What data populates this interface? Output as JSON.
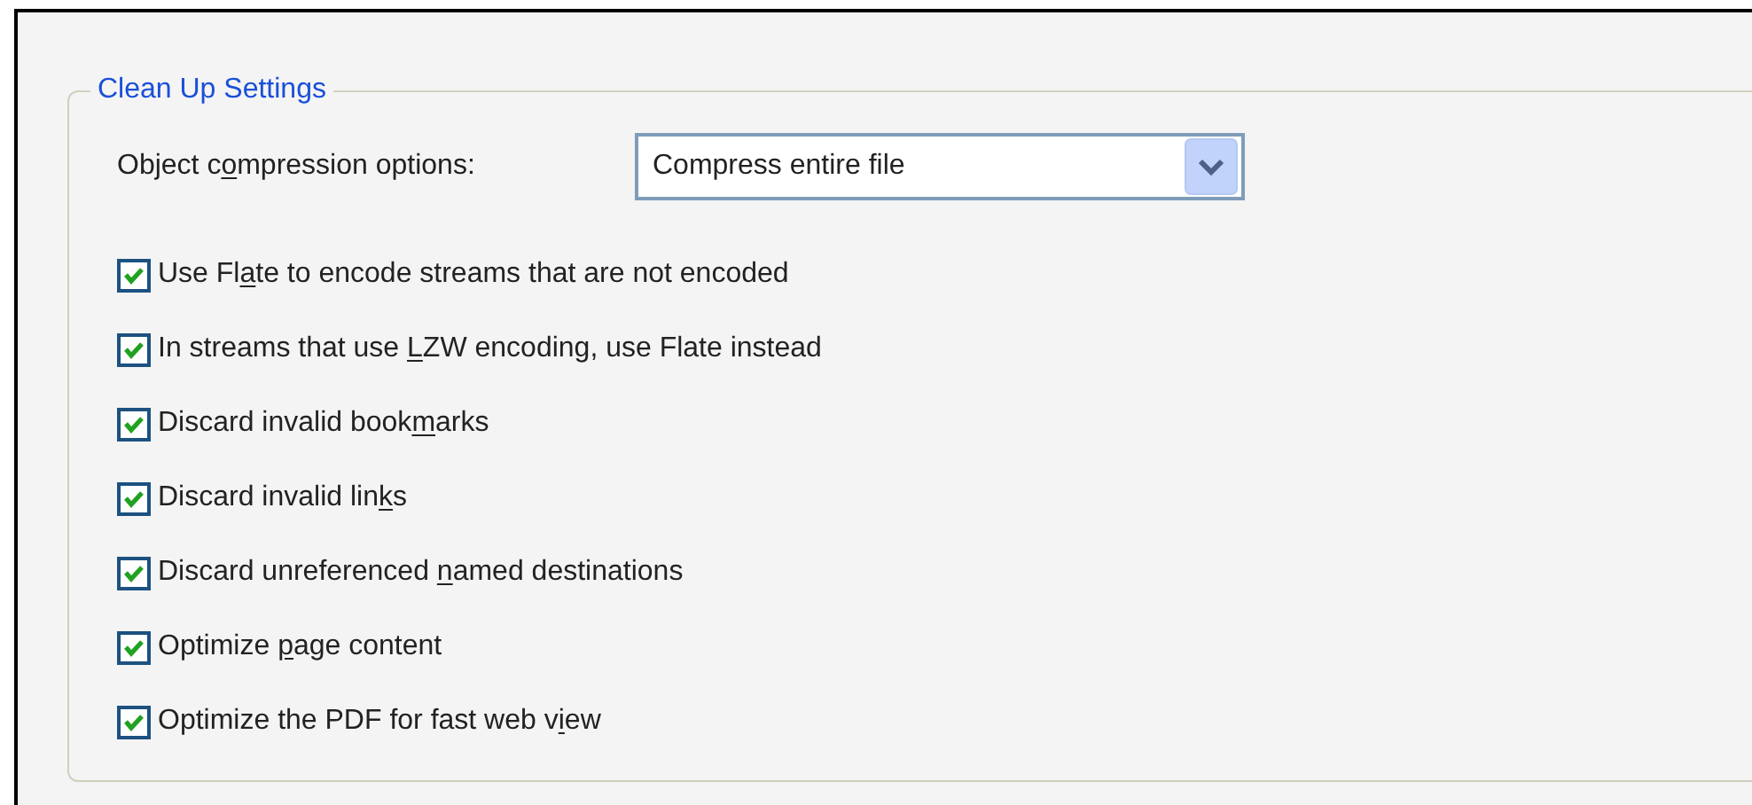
{
  "group": {
    "title": "Clean Up Settings",
    "compression": {
      "label": [
        "Object c",
        "o",
        "mpression options:"
      ],
      "value": "Compress entire file"
    },
    "options": [
      {
        "label": [
          "Use Fl",
          "a",
          "te to encode streams that are not encoded"
        ],
        "checked": true
      },
      {
        "label": [
          "In streams that use ",
          "L",
          "ZW encoding, use Flate instead"
        ],
        "checked": true
      },
      {
        "label": [
          "Discard invalid book",
          "m",
          "arks"
        ],
        "checked": true
      },
      {
        "label": [
          "Discard invalid lin",
          "k",
          "s"
        ],
        "checked": true
      },
      {
        "label": [
          "Discard unreferenced ",
          "n",
          "amed destinations"
        ],
        "checked": true
      },
      {
        "label": [
          "Optimize ",
          "p",
          "age content"
        ],
        "checked": true
      },
      {
        "label": [
          "Optimize the PDF for fast web v",
          "i",
          "ew"
        ],
        "checked": true
      }
    ]
  }
}
